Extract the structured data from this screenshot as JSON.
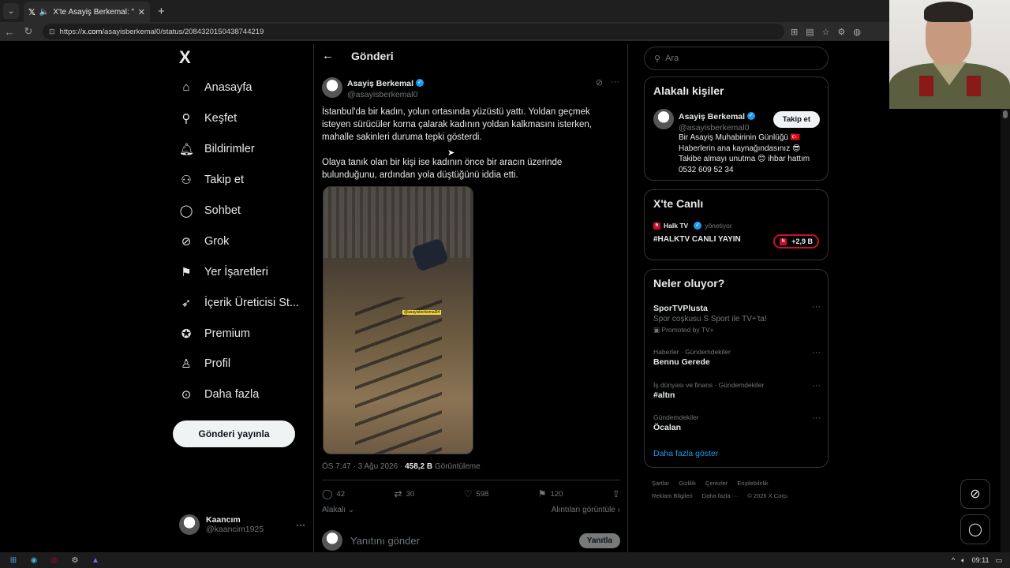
{
  "browser": {
    "tab_title": "X'te Asayiş Berkemal: \"İstanbu",
    "url_prefix": "https://",
    "url_domain": "x.com",
    "url_path": "/asayisberkemal0/status/2084320150438744219"
  },
  "nav": {
    "logo": "X",
    "items": [
      {
        "label": "Anasayfa",
        "icon": "home-icon"
      },
      {
        "label": "Keşfet",
        "icon": "search-icon"
      },
      {
        "label": "Bildirimler",
        "icon": "bell-icon"
      },
      {
        "label": "Takip et",
        "icon": "person-add-icon"
      },
      {
        "label": "Sohbet",
        "icon": "chat-icon"
      },
      {
        "label": "Grok",
        "icon": "grok-icon"
      },
      {
        "label": "Yer İşaretleri",
        "icon": "bookmark-icon"
      },
      {
        "label": "İçerik Üreticisi St...",
        "icon": "rocket-icon"
      },
      {
        "label": "Premium",
        "icon": "verified-icon"
      },
      {
        "label": "Profil",
        "icon": "profile-icon"
      },
      {
        "label": "Daha fazla",
        "icon": "more-circle-icon"
      }
    ],
    "post_button": "Gönderi yayınla",
    "me_name": "Kaancım",
    "me_handle": "@kaancim1925"
  },
  "post": {
    "header_title": "Gönderi",
    "author_name": "Asayiş Berkemal",
    "author_handle": "@asayisberkemal0",
    "paragraph1": "İstanbul'da bir kadın, yolun ortasında yüzüstü yattı. Yoldan geçmek isteyen sürücüler korna çalarak kadının yoldan kalkmasını isterken, mahalle sakinleri duruma tepki gösterdi.",
    "paragraph2": "Olaya tanık olan bir kişi ise kadının önce bir aracın üzerinde bulunduğunu, ardından yola düştüğünü iddia etti.",
    "media_tag": "@asayisberkemal34",
    "timestamp": "ÖS 7:47 · 3 Ağu 2026 · ",
    "views_count": "458,2 B",
    "views_label": "Görüntüleme",
    "replies": "42",
    "reposts": "30",
    "likes": "598",
    "bookmarks": "120",
    "relevant_label": "Alakalı",
    "quotes_label": "Alıntıları görüntüle",
    "reply_placeholder": "Yanıtını gönder",
    "reply_button": "Yanıtla"
  },
  "right": {
    "search_placeholder": "Ara",
    "related_title": "Alakalı kişiler",
    "related_name": "Asayiş Berkemal",
    "related_handle": "@asayisberkemal0",
    "follow_label": "Takip et",
    "bio": "Bir Asayiş Muhabirinin Günlüğü 🇹🇷 Haberlerin ana kaynağındasınız 😎 Takibe almayı unutma 😊 ihbar hattım 0532 609 52 34",
    "live_title": "X'te Canlı",
    "live_source": "Halk TV",
    "live_role": "yönetiyor",
    "live_name": "#HALKTV CANLI YAYIN",
    "live_count": "+2,9 B",
    "trends_title": "Neler oluyor?",
    "trends": [
      {
        "context": "",
        "title": "SporTVPlusta",
        "sub": "Spor coşkusu S Sport ile TV+'ta!",
        "promo": "Promoted by TV+"
      },
      {
        "context": "Haberler · Gündemdekiler",
        "title": "Bennu Gerede"
      },
      {
        "context": "İş dünyası ve finans · Gündemdekiler",
        "title": "#altın"
      },
      {
        "context": "Gündemdekiler",
        "title": "Öcalan"
      }
    ],
    "show_more": "Daha fazla göster",
    "footer": [
      "Şartlar",
      "Gizlilik",
      "Çerezler",
      "Erişilebilirlik",
      "Reklam Bilgileri",
      "Daha fazla ···",
      "© 2026 X Corp."
    ]
  },
  "taskbar": {
    "time": "09:11"
  }
}
